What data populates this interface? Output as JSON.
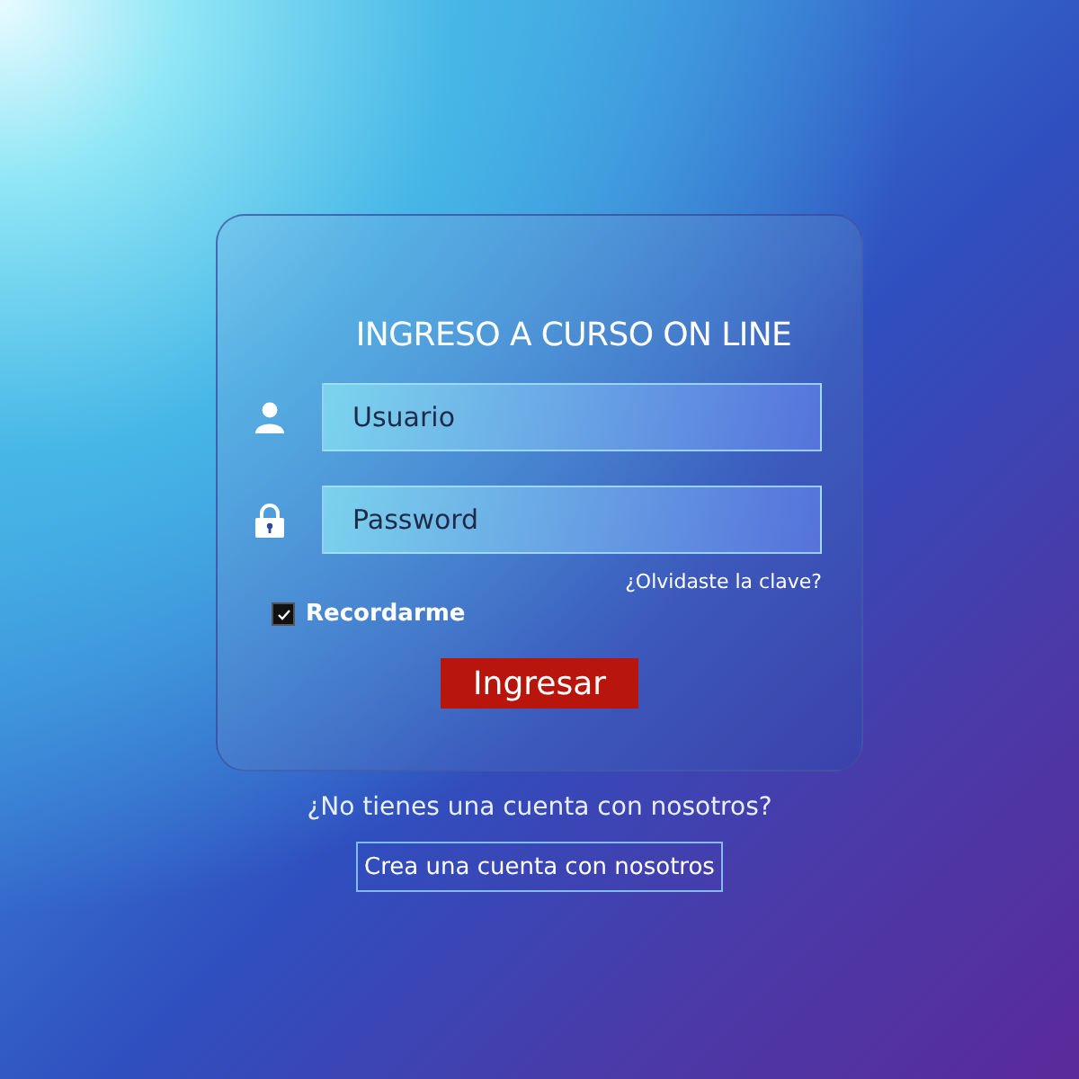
{
  "login": {
    "title": "INGRESO A CURSO ON LINE",
    "fields": [
      {
        "kind": "user",
        "placeholder": "Usuario"
      },
      {
        "kind": "password",
        "placeholder": "Password"
      }
    ],
    "forgot_link": "¿Olvidaste la clave?",
    "remember": {
      "label": "Recordarme",
      "checked": true
    },
    "submit": "Ingresar"
  },
  "signup": {
    "prompt": "¿No tienes una cuenta con nosotros?",
    "button": "Crea una cuenta con nosotros"
  }
}
